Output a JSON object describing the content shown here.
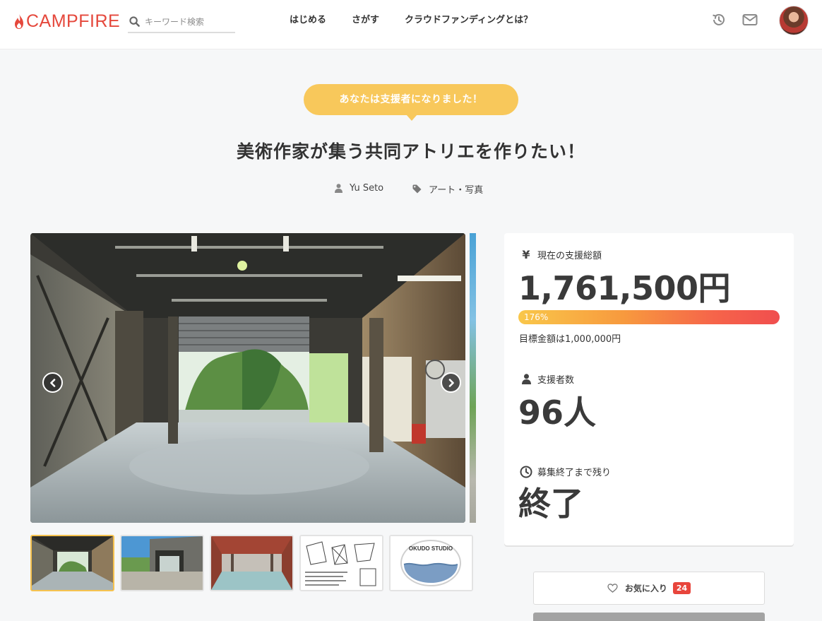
{
  "brand": {
    "name": "CAMPFIRE",
    "color": "#e5483c"
  },
  "search": {
    "placeholder": "キーワード検索",
    "icon": "search-icon"
  },
  "nav": {
    "start": "はじめる",
    "find": "さがす",
    "about": "クラウドファンディングとは？"
  },
  "header_icons": [
    "history-icon",
    "mail-icon",
    "avatar"
  ],
  "badge": {
    "text": "あなたは支援者になりました！",
    "color": "#f8c85b"
  },
  "project": {
    "title": "美術作家が集う共同アトリエを作りたい！",
    "owner": "Yu Seto",
    "category": "アート・写真"
  },
  "gallery": {
    "thumbnails": [
      "garage-interior",
      "building-exterior",
      "red-roof-hall",
      "floor-plan",
      "okudo-studio-logo"
    ],
    "active_index": 0,
    "logo_text": "OKUDO STUDIO"
  },
  "stats": {
    "total_label": "現在の支援総額",
    "total_value": "1,761,500円",
    "progress_percent": 176,
    "progress_text": "176%",
    "goal_text": "目標金額は1,000,000円",
    "backers_label": "支援者数",
    "backers_value": "96人",
    "remaining_label": "募集終了まで残り",
    "remaining_value": "終了",
    "currency_symbol": "¥"
  },
  "favorite": {
    "label": "お気に入り",
    "count": "24"
  },
  "colors": {
    "progress_start": "#f9c74a",
    "progress_end": "#f04e4e",
    "fav_badge": "#e8453c"
  }
}
